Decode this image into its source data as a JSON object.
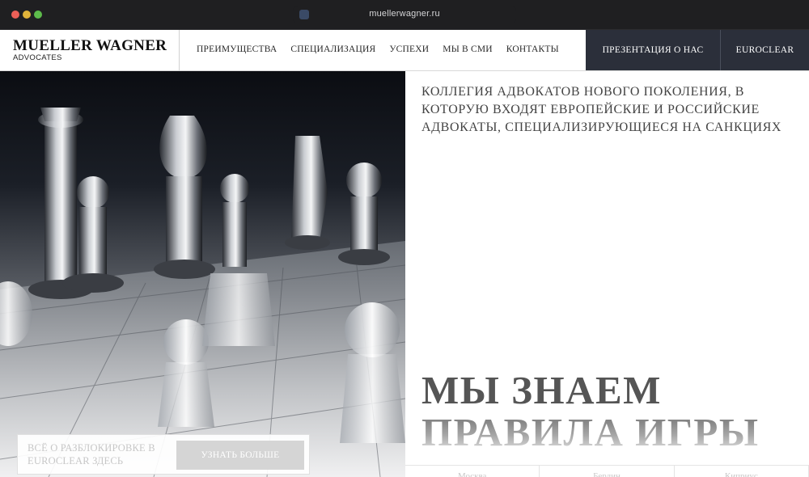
{
  "browser": {
    "url": "muellerwagner.ru"
  },
  "header": {
    "logo_name": "MUELLER WAGNER",
    "logo_sub": "ADVOCATES",
    "nav": [
      "ПРЕИМУЩЕСТВА",
      "СПЕЦИАЛИЗАЦИЯ",
      "УСПЕХИ",
      "МЫ В СМИ",
      "КОНТАКТЫ"
    ],
    "presentation_label": "ПРЕЗЕНТАЦИЯ О НАС",
    "euroclear_label": "EUROCLEAR"
  },
  "hero": {
    "tagline": "КОЛЛЕГИЯ АДВОКАТОВ НОВОГО ПОКОЛЕНИЯ, В КОТОРУЮ ВХОДЯТ ЕВРОПЕЙСКИЕ И РОССИЙСКИЕ АДВОКАТЫ, СПЕЦИАЛИЗИРУЮЩИЕСЯ НА САНКЦИЯХ",
    "headline_line1": "МЫ ЗНАЕМ",
    "headline_line2": "ПРАВИЛА ИГРЫ",
    "bottom_tabs": [
      "Москва",
      "Берлин",
      "Киприус"
    ]
  },
  "promo": {
    "text": "ВСЁ О РАЗБЛОКИРОВКЕ В EUROCLEAR ЗДЕСЬ",
    "button_label": "УЗНАТЬ БОЛЬШЕ"
  },
  "colors": {
    "dark_button": "#2b2f3a",
    "headline": "#555555"
  }
}
